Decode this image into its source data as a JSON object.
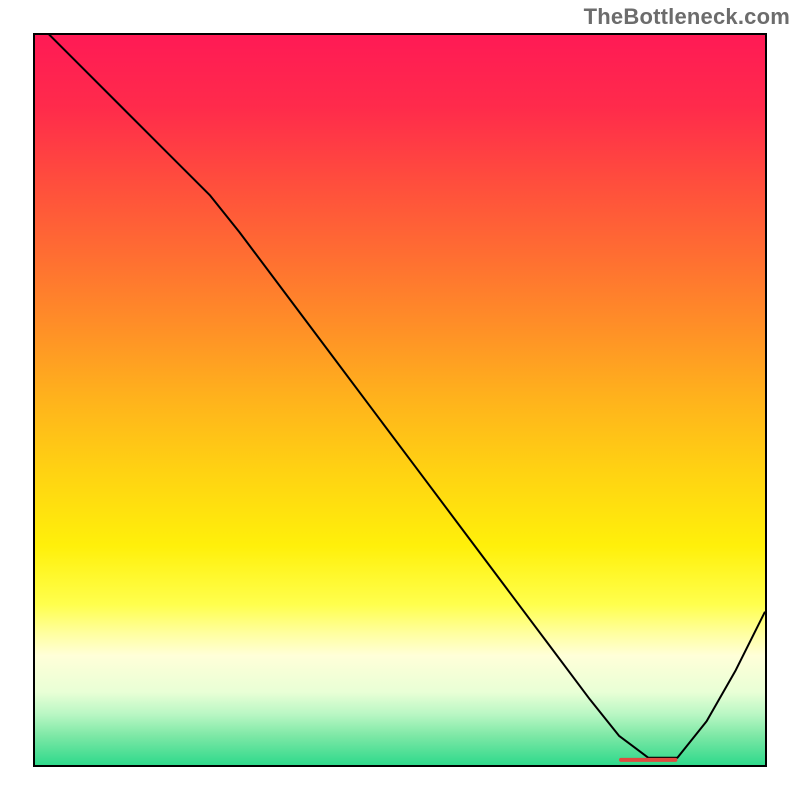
{
  "attribution": {
    "text": "TheBottleneck.com"
  },
  "chart_data": {
    "type": "line",
    "title": "",
    "xlabel": "",
    "ylabel": "",
    "xlim": [
      0,
      100
    ],
    "ylim": [
      0,
      100
    ],
    "background_gradient_stops": [
      {
        "offset": 0.0,
        "color": "#ff1a55"
      },
      {
        "offset": 0.1,
        "color": "#ff2b4b"
      },
      {
        "offset": 0.2,
        "color": "#ff4d3d"
      },
      {
        "offset": 0.3,
        "color": "#ff6d32"
      },
      {
        "offset": 0.4,
        "color": "#ff8f27"
      },
      {
        "offset": 0.5,
        "color": "#ffb31c"
      },
      {
        "offset": 0.6,
        "color": "#ffd312"
      },
      {
        "offset": 0.7,
        "color": "#fff00a"
      },
      {
        "offset": 0.78,
        "color": "#ffff4d"
      },
      {
        "offset": 0.82,
        "color": "#ffffa0"
      },
      {
        "offset": 0.85,
        "color": "#ffffd8"
      },
      {
        "offset": 0.9,
        "color": "#e9ffd6"
      },
      {
        "offset": 0.93,
        "color": "#baf7c4"
      },
      {
        "offset": 0.96,
        "color": "#7de8a6"
      },
      {
        "offset": 1.0,
        "color": "#2fd98b"
      }
    ],
    "series": [
      {
        "name": "bottleneck-curve",
        "color": "#000000",
        "width": 2,
        "x": [
          0,
          6,
          12,
          18,
          24,
          28,
          34,
          40,
          46,
          52,
          58,
          64,
          70,
          76,
          80,
          84,
          88,
          92,
          96,
          100
        ],
        "y": [
          102,
          96,
          90,
          84,
          78,
          73,
          65,
          57,
          49,
          41,
          33,
          25,
          17,
          9,
          4,
          1,
          1,
          6,
          13,
          21
        ]
      }
    ],
    "optimal_marker": {
      "label": "",
      "color": "#e04a3f",
      "x_start": 80,
      "x_end": 88,
      "y": 0.7,
      "thickness": 4
    }
  }
}
